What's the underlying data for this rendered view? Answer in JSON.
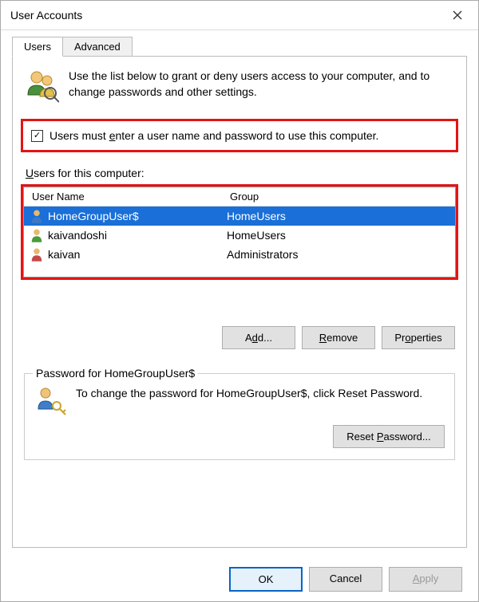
{
  "window": {
    "title": "User Accounts"
  },
  "tabs": {
    "users": "Users",
    "advanced": "Advanced"
  },
  "intro": {
    "text": "Use the list below to grant or deny users access to your computer, and to change passwords and other settings."
  },
  "checkbox": {
    "checked": "✓",
    "label_pre": "Users must ",
    "label_u": "e",
    "label_post": "nter a user name and password to use this computer."
  },
  "list": {
    "label_u": "U",
    "label_post": "sers for this computer:",
    "col_name": "User Name",
    "col_group": "Group",
    "rows": [
      {
        "name": "HomeGroupUser$",
        "group": "HomeUsers",
        "selected": true
      },
      {
        "name": "kaivandoshi",
        "group": "HomeUsers",
        "selected": false
      },
      {
        "name": "kaivan",
        "group": "Administrators",
        "selected": false
      }
    ]
  },
  "buttons": {
    "add_pre": "A",
    "add_u": "d",
    "add_post": "d...",
    "remove_u": "R",
    "remove_post": "emove",
    "props_pre": "Pr",
    "props_u": "o",
    "props_post": "perties"
  },
  "password_box": {
    "legend": "Password for HomeGroupUser$",
    "text": "To change the password for HomeGroupUser$, click Reset Password.",
    "reset_pre": "Reset ",
    "reset_u": "P",
    "reset_post": "assword..."
  },
  "footer": {
    "ok": "OK",
    "cancel": "Cancel",
    "apply_u": "A",
    "apply_post": "pply"
  }
}
